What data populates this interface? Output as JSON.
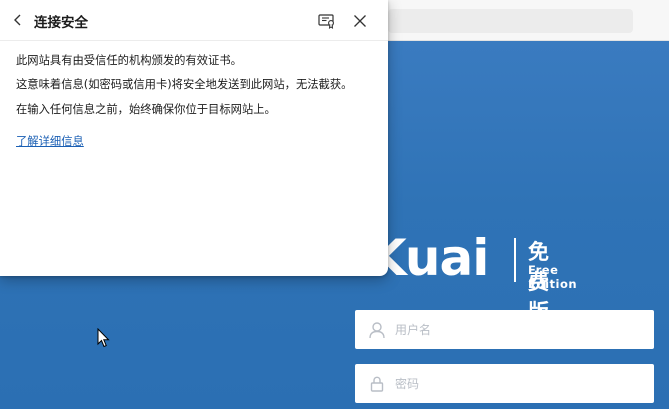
{
  "popup": {
    "title": "连接安全",
    "lines": [
      "此网站具有由受信任的机构颁发的有效证书。",
      "这意味着信息(如密码或信用卡)将安全地发送到此网站，无法截获。",
      "在输入任何信息之前，始终确保你位于目标网站上。"
    ],
    "link": "了解详细信息"
  },
  "logo": {
    "word": "Kuai",
    "cn": "免费版",
    "en": "Free Edition"
  },
  "login": {
    "username_placeholder": "用户名",
    "password_placeholder": "密码"
  },
  "colors": {
    "page_bg": "#2e74b5",
    "link": "#1a5fb4",
    "placeholder": "#b9bec6"
  }
}
